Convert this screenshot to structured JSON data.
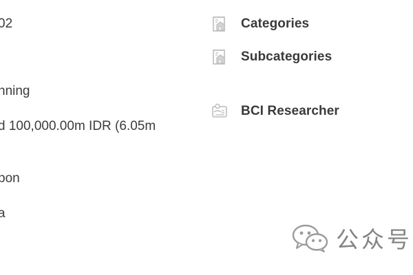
{
  "left_column": {
    "lines": [
      "02",
      "nning",
      "d 100,000.00m IDR (6.05m",
      "pon",
      "a"
    ]
  },
  "right_column": {
    "items": [
      {
        "label": "Categories",
        "icon": "building-document-icon"
      },
      {
        "label": "Subcategories",
        "icon": "building-document-icon"
      },
      {
        "label": "BCI Researcher",
        "icon": "id-card-person-icon"
      }
    ]
  },
  "watermark": {
    "text": "公众号",
    "icon": "wechat-logo-icon"
  },
  "colors": {
    "text": "#3a3a3a",
    "icon": "#bcbcbc",
    "watermark": "#5b5b5b"
  }
}
